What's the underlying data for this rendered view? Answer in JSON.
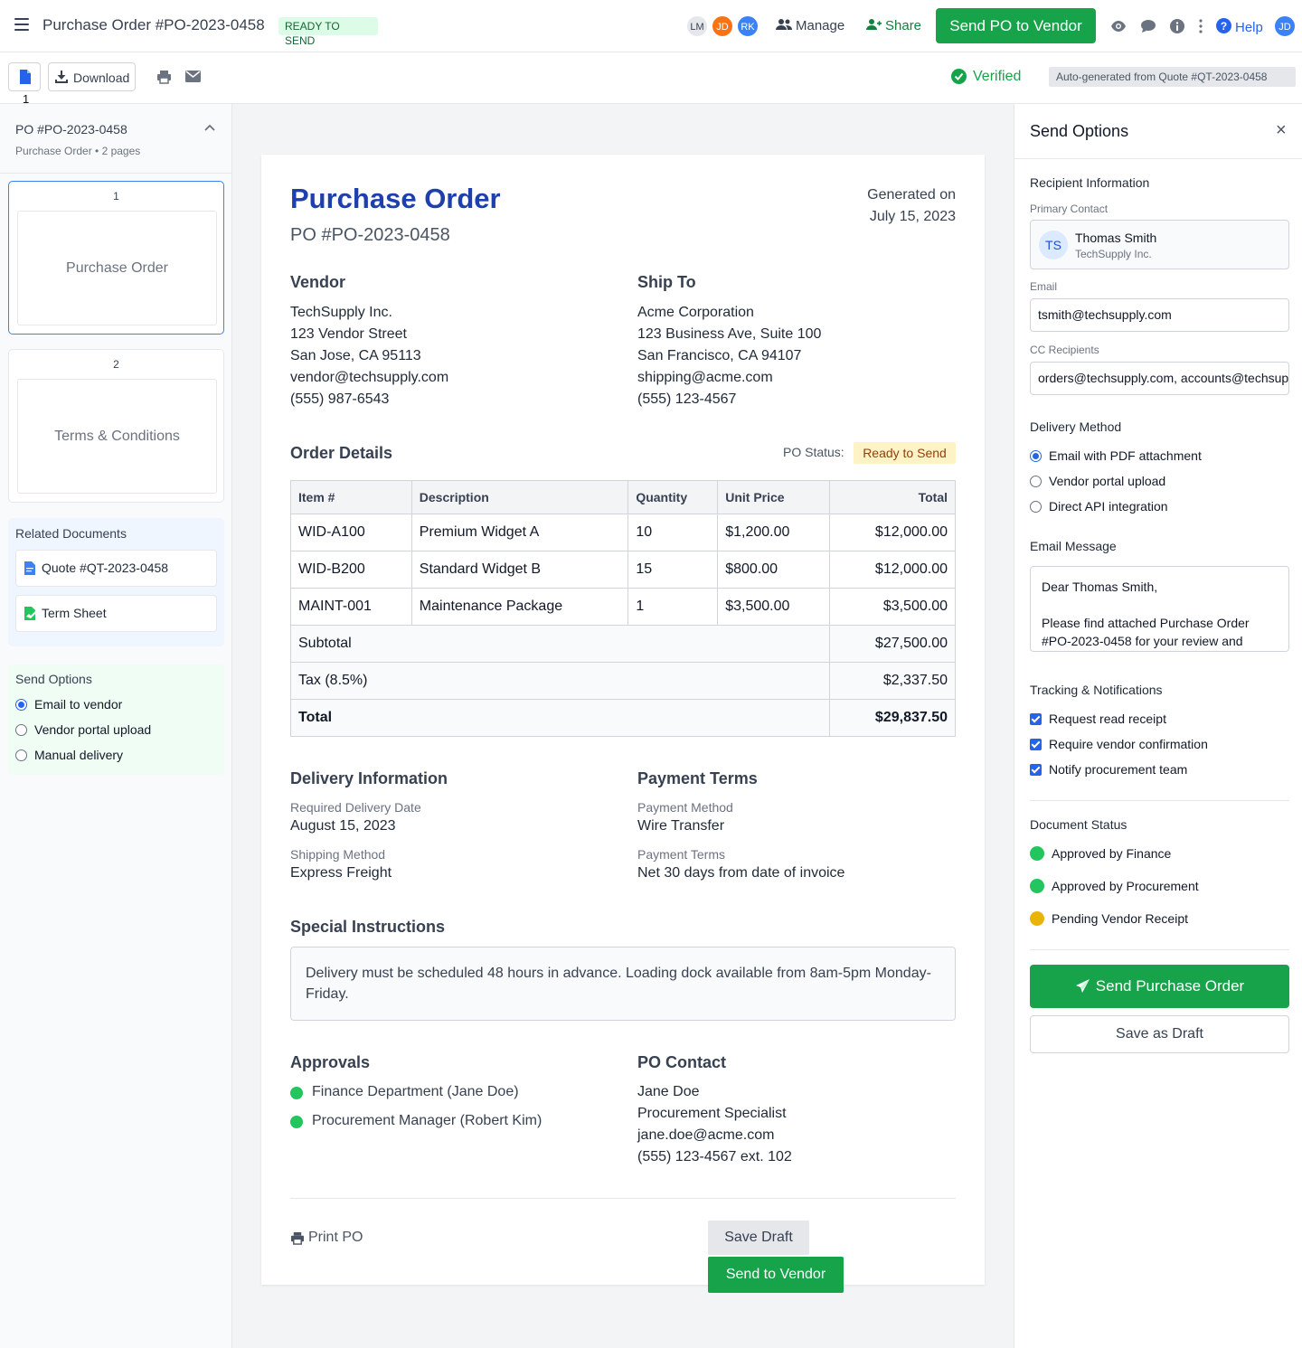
{
  "topbar": {
    "title": "Purchase Order #PO-2023-0458",
    "status": "READY TO SEND",
    "avatars": [
      {
        "initials": "LM",
        "color": "#e5e7eb",
        "text": "#374151"
      },
      {
        "initials": "JD",
        "color": "#f97316",
        "text": "#ffffff"
      },
      {
        "initials": "RK",
        "color": "#3b82f6",
        "text": "#ffffff"
      }
    ],
    "manage_label": "Manage",
    "share_label": "Share",
    "send_label": "Send PO to Vendor",
    "help_label": "Help",
    "user_initials": "JD"
  },
  "toolbar": {
    "page_number": "1",
    "download_label": "Download",
    "verified_label": "Verified",
    "autogen_label": "Auto-generated from Quote #QT-2023-0458"
  },
  "sidebar": {
    "title": "PO #PO-2023-0458",
    "subtitle": "Purchase Order • 2 pages",
    "pages": [
      {
        "number": "1",
        "label": "Purchase Order"
      },
      {
        "number": "2",
        "label": "Terms & Conditions"
      }
    ],
    "related_title": "Related Documents",
    "related": [
      "Quote #QT-2023-0458",
      "Term Sheet"
    ],
    "send_title": "Send Options",
    "send_options": [
      "Email to vendor",
      "Vendor portal upload",
      "Manual delivery"
    ]
  },
  "document": {
    "heading": "Purchase Order",
    "po_number": "PO #PO-2023-0458",
    "generated_label": "Generated on",
    "generated_date": "July 15, 2023",
    "vendor_title": "Vendor",
    "vendor_lines": [
      "TechSupply Inc.",
      "123 Vendor Street",
      "San Jose, CA 95113",
      "vendor@techsupply.com",
      "(555) 987-6543"
    ],
    "shipto_title": "Ship To",
    "shipto_lines": [
      "Acme Corporation",
      "123 Business Ave, Suite 100",
      "San Francisco, CA 94107",
      "shipping@acme.com",
      "(555) 123-4567"
    ],
    "order_title": "Order Details",
    "po_status_label": "PO Status:",
    "po_status_value": "Ready to Send",
    "columns": [
      "Item #",
      "Description",
      "Quantity",
      "Unit Price",
      "Total"
    ],
    "rows": [
      [
        "WID-A100",
        "Premium Widget A",
        "10",
        "$1,200.00",
        "$12,000.00"
      ],
      [
        "WID-B200",
        "Standard Widget B",
        "15",
        "$800.00",
        "$12,000.00"
      ],
      [
        "MAINT-001",
        "Maintenance Package",
        "1",
        "$3,500.00",
        "$3,500.00"
      ]
    ],
    "subtotal_label": "Subtotal",
    "subtotal_value": "$27,500.00",
    "tax_label": "Tax (8.5%)",
    "tax_value": "$2,337.50",
    "total_label": "Total",
    "total_value": "$29,837.50",
    "delivery_title": "Delivery Information",
    "req_date_label": "Required Delivery Date",
    "req_date_value": "August 15, 2023",
    "ship_method_label": "Shipping Method",
    "ship_method_value": "Express Freight",
    "payment_title": "Payment Terms",
    "pay_method_label": "Payment Method",
    "pay_method_value": "Wire Transfer",
    "pay_terms_label": "Payment Terms",
    "pay_terms_value": "Net 30 days from date of invoice",
    "instructions_title": "Special Instructions",
    "instructions": "Delivery must be scheduled 48 hours in advance. Loading dock available from 8am-5pm Monday-Friday.",
    "approvals_title": "Approvals",
    "approvals": [
      "Finance Department (Jane Doe)",
      "Procurement Manager (Robert Kim)"
    ],
    "contact_title": "PO Contact",
    "contact_lines": [
      "Jane Doe",
      "Procurement Specialist",
      "jane.doe@acme.com",
      "(555) 123-4567 ext. 102"
    ],
    "print_label": "Print PO",
    "save_draft_label": "Save Draft",
    "send_vendor_label": "Send to Vendor"
  },
  "panel": {
    "title": "Send Options",
    "recipient_title": "Recipient Information",
    "primary_label": "Primary Contact",
    "contact_initials": "TS",
    "contact_name": "Thomas Smith",
    "contact_company": "TechSupply Inc.",
    "email_label": "Email",
    "email_value": "tsmith@techsupply.com",
    "cc_label": "CC Recipients",
    "cc_value": "orders@techsupply.com, accounts@techsupply.com",
    "delivery_title": "Delivery Method",
    "delivery_options": [
      "Email with PDF attachment",
      "Vendor portal upload",
      "Direct API integration"
    ],
    "message_title": "Email Message",
    "message": "Dear Thomas Smith,\n\nPlease find attached Purchase Order #PO-2023-0458 for your review and",
    "tracking_title": "Tracking & Notifications",
    "tracking": [
      "Request read receipt",
      "Require vendor confirmation",
      "Notify procurement team"
    ],
    "status_title": "Document Status",
    "statuses": [
      {
        "label": "Approved by Finance",
        "color": "#22c55e"
      },
      {
        "label": "Approved by Procurement",
        "color": "#22c55e"
      },
      {
        "label": "Pending Vendor Receipt",
        "color": "#eab308"
      }
    ],
    "send_button": "Send Purchase Order",
    "draft_button": "Save as Draft"
  },
  "colors": {
    "accent_green": "#16a34a",
    "brand_blue": "#1e40af"
  }
}
